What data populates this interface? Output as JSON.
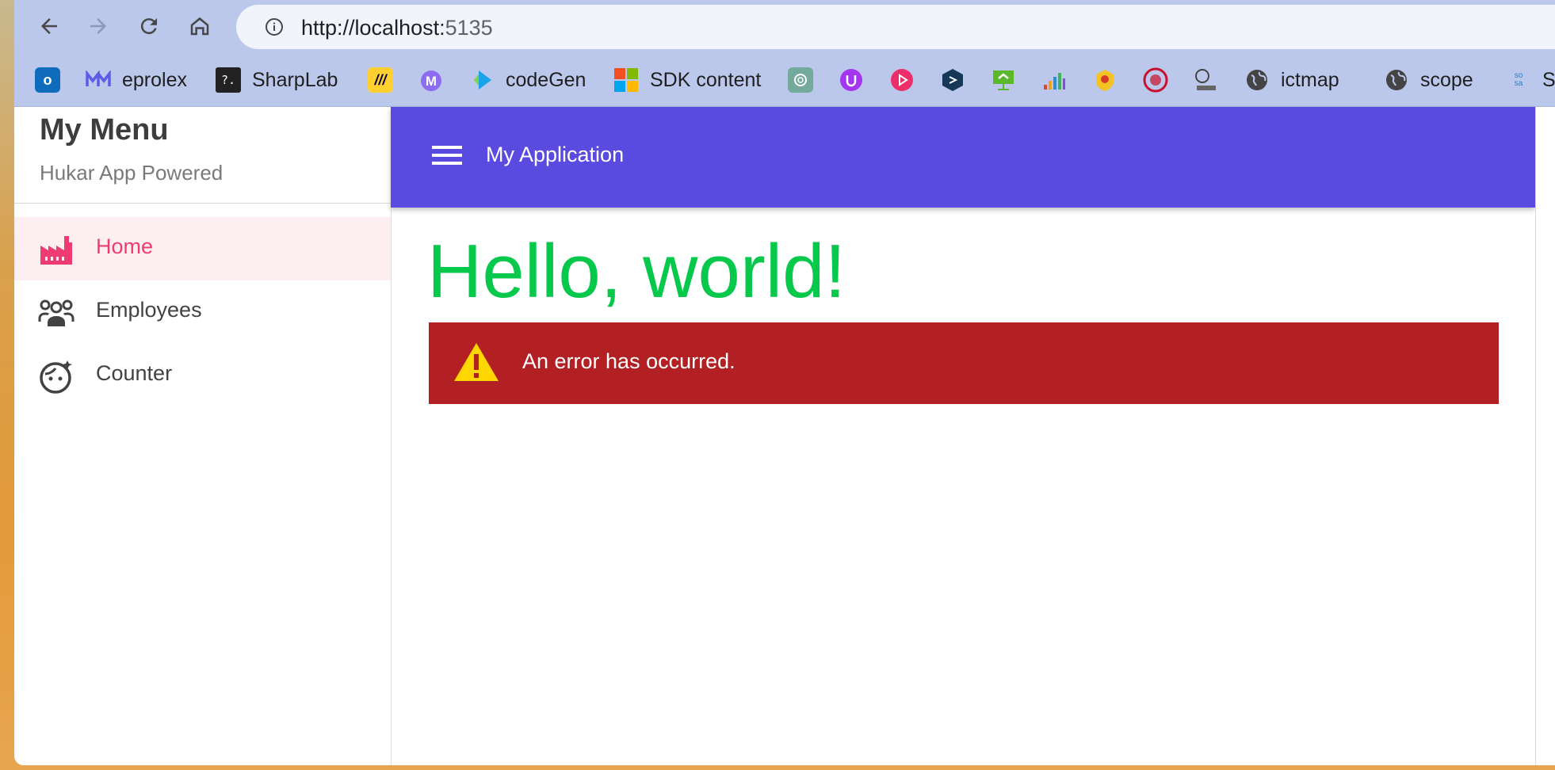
{
  "browser": {
    "url_host": "http://localhost:",
    "url_port": "5135"
  },
  "bookmarks": [
    {
      "label": "",
      "icon": "outlook-icon",
      "color": "#0f6cbd"
    },
    {
      "label": "eprolex",
      "icon": "eprolex-icon",
      "color": "#5b5ce6"
    },
    {
      "label": "SharpLab",
      "icon": "terminal-icon",
      "color": "#222222"
    },
    {
      "label": "",
      "icon": "miro-icon",
      "color": "#ffd02f"
    },
    {
      "label": "",
      "icon": "m-logo-icon",
      "color": "#8c6cf0"
    },
    {
      "label": "codeGen",
      "icon": "play-arrow-icon",
      "color": "#1aa3e8"
    },
    {
      "label": "SDK content",
      "icon": "microsoft-icon",
      "color": "#f25022"
    },
    {
      "label": "",
      "icon": "chatgpt-icon",
      "color": "#74aa9c"
    },
    {
      "label": "",
      "icon": "u-circle-icon",
      "color": "#a435f0"
    },
    {
      "label": "",
      "icon": "play-circle-icon",
      "color": "#ee2e6b"
    },
    {
      "label": "",
      "icon": "share-hex-icon",
      "color": "#153859"
    },
    {
      "label": "",
      "icon": "presentation-icon",
      "color": "#5cb82b"
    },
    {
      "label": "",
      "icon": "bar-graph-icon",
      "color": "#f0a020"
    },
    {
      "label": "",
      "icon": "emblem-icon",
      "color": "#d83b2b"
    },
    {
      "label": "",
      "icon": "red-seal-icon",
      "color": "#c8102e"
    },
    {
      "label": "",
      "icon": "epro-admin-icon",
      "color": "#444444"
    },
    {
      "label": "ictmap",
      "icon": "globe-icon",
      "color": "#444444"
    },
    {
      "label": "scope",
      "icon": "globe-icon",
      "color": "#444444"
    },
    {
      "label": "SA",
      "icon": "so-sa-icon",
      "color": "#2e7bbf"
    }
  ],
  "drawer": {
    "title": "My Menu",
    "subtitle": "Hukar App Powered",
    "items": [
      {
        "label": "Home",
        "icon": "factory-icon",
        "active": true
      },
      {
        "label": "Employees",
        "icon": "group-icon",
        "active": false
      },
      {
        "label": "Counter",
        "icon": "face-icon",
        "active": false
      }
    ]
  },
  "appbar": {
    "title": "My Application"
  },
  "main": {
    "heading": "Hello, world!",
    "alert_text": "An error has occurred."
  },
  "colors": {
    "appbar": "#5a4be0",
    "active_nav": "#ee3b73",
    "heading": "#06c84a",
    "alert": "#b32024"
  }
}
